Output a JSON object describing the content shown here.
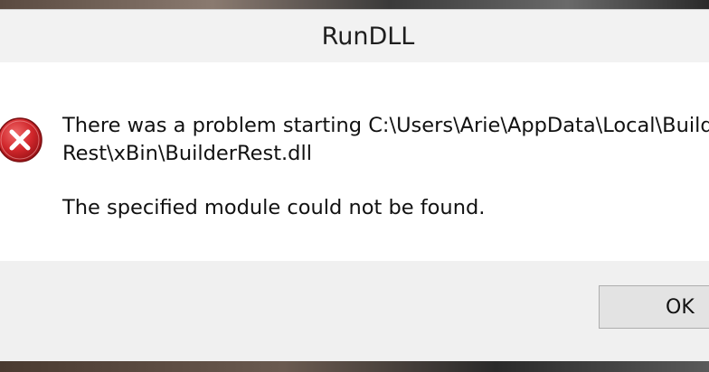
{
  "window": {
    "title": "RunDLL"
  },
  "message": {
    "icon": "error-icon",
    "line1": "There was a problem starting C:\\Users\\Arie\\AppData\\Local\\Builder",
    "line2": "Rest\\xBin\\BuilderRest.dll",
    "detail": "The specified module could not be found."
  },
  "buttons": {
    "ok_label": "OK"
  },
  "colors": {
    "error_red": "#c9262b",
    "dialog_bg": "#ffffff",
    "footer_bg": "#f0f0f0"
  }
}
